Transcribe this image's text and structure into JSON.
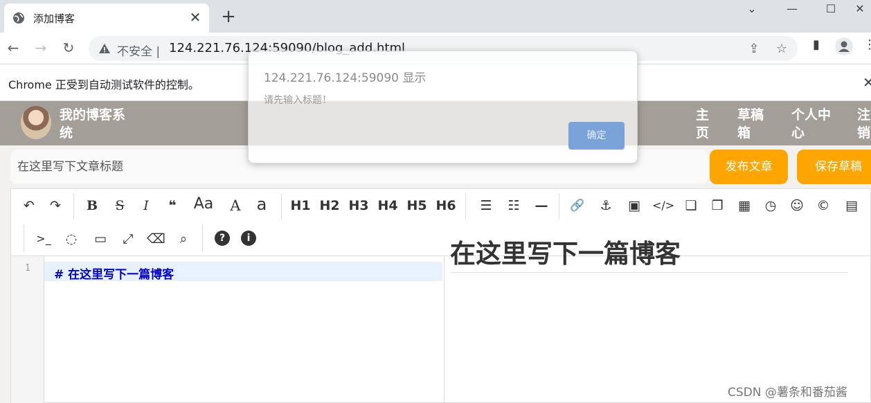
{
  "browser": {
    "tab_title": "添加博客",
    "tab_close": "✕",
    "new_tab": "+",
    "minimize": "—",
    "maximize": "☐",
    "close": "✕",
    "tablist": "⌄",
    "back": "←",
    "forward": "→",
    "reload": "↻",
    "insecure_label": "不安全 |",
    "url": "124.221.76.124:59090/blog_add.html",
    "share_icon": "⇪",
    "star_icon": "☆",
    "sidepanel_icon": "▮",
    "menu_icon": "⋮",
    "infobar_text": "Chrome 正受到自动测试软件的控制。",
    "infobar_close": "✕"
  },
  "site": {
    "name": "我的博客系统",
    "nav": [
      "主页",
      "草稿箱",
      "个人中心",
      "注销"
    ]
  },
  "editor": {
    "title_placeholder": "在这里写下文章标题",
    "publish_label": "发布文章",
    "draft_label": "保存草稿",
    "toolbar_row1": [
      "↶",
      "↷",
      "B",
      "S",
      "I",
      "❝",
      "Aa",
      "A",
      "a",
      "H1",
      "H2",
      "H3",
      "H4",
      "H5",
      "H6",
      "☰",
      "☷",
      "—",
      "🔗",
      "⚓",
      "▣",
      "</>",
      "❏",
      "❐",
      "▦",
      "◷",
      "☺",
      "©",
      "▤"
    ],
    "toolbar_row2": [
      ">_",
      "◌",
      "▭",
      "⤢",
      "⌫",
      "⌕",
      "?",
      "i"
    ],
    "line_number": "1",
    "markdown_line": "# 在这里写下一篇博客",
    "preview_heading": "在这里写下一篇博客"
  },
  "dialog": {
    "title": "124.221.76.124:59090 显示",
    "message": "请先输入标题！",
    "ok_label": "确定"
  },
  "watermark": "CSDN @薯条和番茄酱",
  "colors": {
    "accent": "#ffa500",
    "header_bg": "#a39e98",
    "dialog_ok": "#7aa3d9",
    "markdown_text": "#0000cc"
  }
}
